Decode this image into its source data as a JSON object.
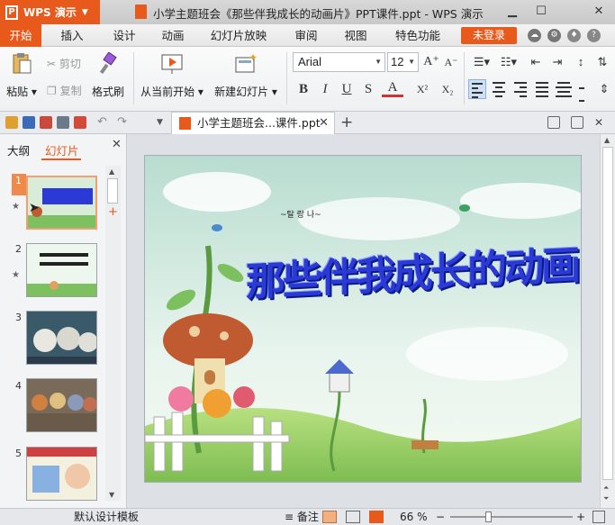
{
  "app": {
    "logo": "WPS 演示",
    "window_title": "小学主题班会《那些伴我成长的动画片》PPT课件.ppt - WPS 演示"
  },
  "menu": {
    "tabs": [
      "开始",
      "插入",
      "设计",
      "动画",
      "幻灯片放映",
      "审阅",
      "视图",
      "特色功能"
    ],
    "active_tab": "开始",
    "login": "未登录"
  },
  "ribbon": {
    "paste": "粘贴",
    "cut": "剪切",
    "copy": "复制",
    "format_painter": "格式刷",
    "play_from_current": "从当前开始",
    "new_slide": "新建幻灯片",
    "font": "Arial",
    "font_size": "12",
    "bold": "B",
    "italic": "I",
    "underline": "U",
    "strike": "S",
    "font_color": "A",
    "superscript": "X²",
    "subscript": "X₂",
    "grow": "A⁺",
    "shrink": "A⁻"
  },
  "document_tab": {
    "name": "小学主题班会...课件.ppt"
  },
  "left_panel": {
    "tabs": [
      "大纲",
      "幻灯片"
    ],
    "active_tab": "幻灯片",
    "slides": [
      {
        "num": "1",
        "caption": "那些伴我成长的动画"
      },
      {
        "num": "2",
        "caption": "还记得哪些动画片？"
      },
      {
        "num": "3",
        "caption": ""
      },
      {
        "num": "4",
        "caption": ""
      },
      {
        "num": "5",
        "caption": ""
      }
    ]
  },
  "slide": {
    "title": "那些伴我成长的动画",
    "doodle_text": "~탈 랑 나~"
  },
  "status": {
    "template": "默认设计模板",
    "notes": "备注",
    "zoom": "66 %"
  },
  "colors": {
    "accent": "#e8591c",
    "title_blue": "#2b39d6"
  }
}
